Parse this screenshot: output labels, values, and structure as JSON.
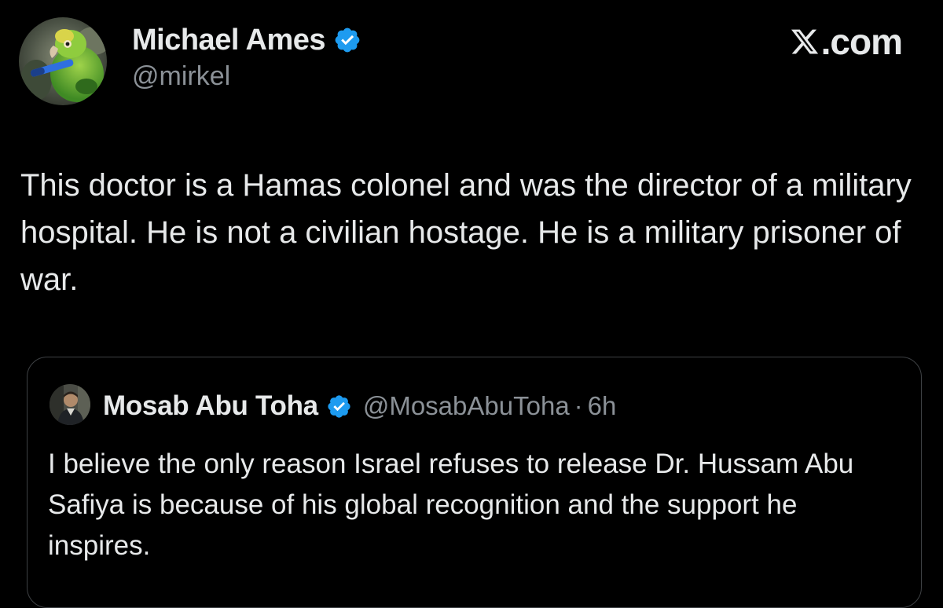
{
  "brand": {
    "label": ".com",
    "icon": "x-logo-icon"
  },
  "post": {
    "author": {
      "name": "Michael Ames",
      "handle": "@mirkel",
      "verified_icon": "verified-badge-icon",
      "avatar": "parrot-avatar"
    },
    "text": "This doctor is a Hamas colonel and was the director of a military hospital. He is not a civilian hostage. He is a military prisoner of war."
  },
  "quoted_post": {
    "author": {
      "name": "Mosab Abu Toha",
      "handle": "@MosabAbuToha",
      "verified_icon": "verified-badge-icon",
      "avatar": "person-avatar"
    },
    "separator": "·",
    "time": "6h",
    "text": "I believe the only reason Israel refuses to release Dr. Hussam Abu Safiya is because of his global recognition and the support he inspires."
  },
  "colors": {
    "background": "#000000",
    "text_primary": "#e7e9ea",
    "text_secondary": "#8b9197",
    "verified_blue": "#1d9bf0",
    "card_border": "#3e4144"
  }
}
